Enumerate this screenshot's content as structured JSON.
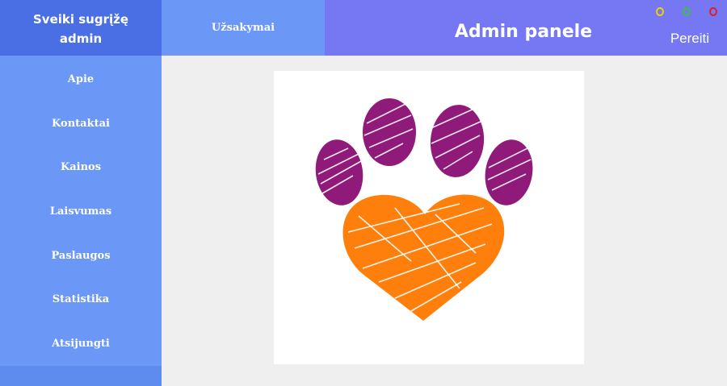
{
  "header": {
    "welcome_text": "Sveiki sugrįžę\nadmin",
    "orders_tab_label": "Užsakymai",
    "title": "Admin panele",
    "goto_label": "Pereiti"
  },
  "window_controls": [
    {
      "name": "yellow-circle-icon",
      "color": "#e8d400"
    },
    {
      "name": "green-circle-icon",
      "color": "#3fbf3f"
    },
    {
      "name": "red-circle-icon",
      "color": "#e02020"
    }
  ],
  "sidebar": {
    "items": [
      {
        "label": "Apie"
      },
      {
        "label": "Kontaktai"
      },
      {
        "label": "Kainos"
      },
      {
        "label": "Laisvumas"
      },
      {
        "label": "Paslaugos"
      },
      {
        "label": "Statistika"
      },
      {
        "label": "Atsijungti"
      }
    ]
  },
  "main": {
    "logo": {
      "icon": "paw-heart-logo-icon",
      "toe_color": "#901a7a",
      "heart_color": "#fe7f0b"
    }
  },
  "colors": {
    "welcome_bg": "#4a6fe5",
    "nav_bg": "#6b97f6",
    "header_bg": "#7578f2",
    "content_bg": "#efefef"
  }
}
